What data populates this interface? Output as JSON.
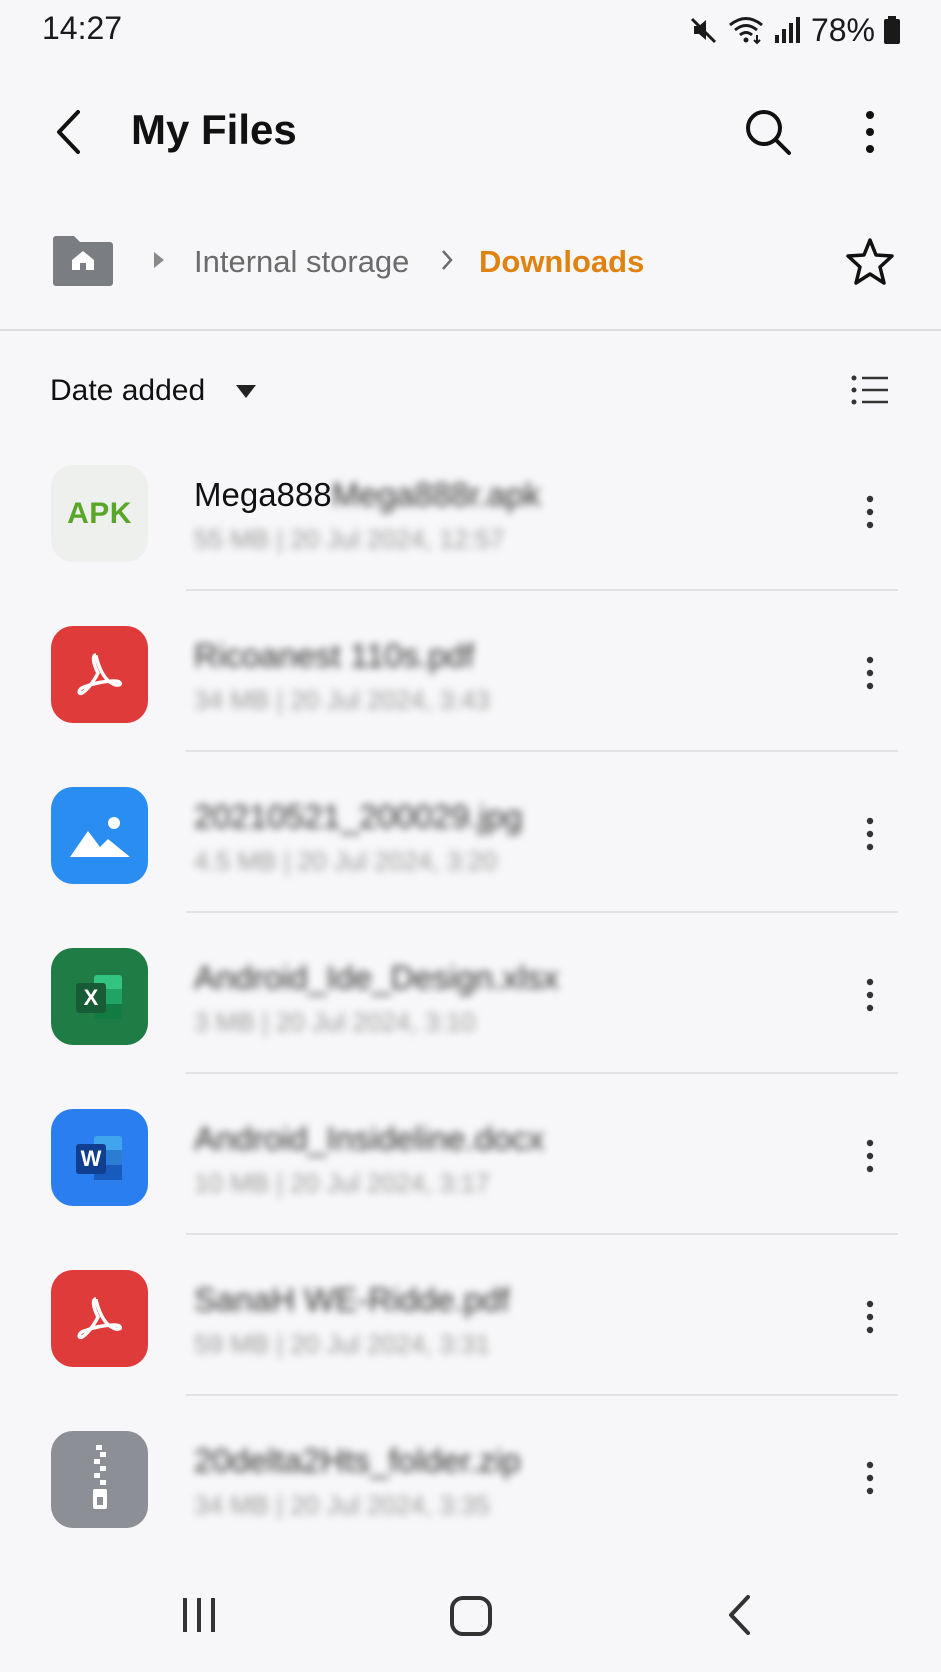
{
  "status_bar": {
    "time": "14:27",
    "battery": "78%",
    "icons": [
      "mute-icon",
      "wifi-icon",
      "signal-icon",
      "battery-icon"
    ]
  },
  "header": {
    "title": "My Files",
    "icons": [
      "back-icon",
      "search-icon",
      "more-vert-icon"
    ]
  },
  "breadcrumb": {
    "items": [
      "Internal storage",
      "Downloads"
    ],
    "active_color": "#e0820f"
  },
  "sort": {
    "label": "Date added"
  },
  "files": [
    {
      "name_visible": "Mega888",
      "name_blurred": "Mega888r.apk",
      "meta": "55 MB  |  20 Jul 2024, 12:57",
      "type": "apk",
      "badge": "APK"
    },
    {
      "name_visible": "",
      "name_blurred": "Ricoanest 110s.pdf",
      "meta": "34 MB  |  20 Jul 2024, 3:43",
      "type": "pdf"
    },
    {
      "name_visible": "",
      "name_blurred": "20210521_200029.jpg",
      "meta": "4.5 MB  |  20 Jul 2024, 3:20",
      "type": "image"
    },
    {
      "name_visible": "",
      "name_blurred": "Android_Ide_Design.xlsx",
      "meta": "3 MB  |  20 Jul 2024, 3:10",
      "type": "excel",
      "badge": "X"
    },
    {
      "name_visible": "",
      "name_blurred": "Android_Insideline.docx",
      "meta": "10 MB  |  20 Jul 2024, 3:17",
      "type": "word",
      "badge": "W"
    },
    {
      "name_visible": "",
      "name_blurred": "SanaH WE-Ridde.pdf",
      "meta": "59 MB  |  20 Jul 2024, 3:31",
      "type": "pdf"
    },
    {
      "name_visible": "",
      "name_blurred": "20delta2Hts_folder.zip",
      "meta": "34 MB  |  20 Jul 2024, 3:35",
      "type": "zip"
    }
  ],
  "nav_bar": {
    "icons": [
      "recents-icon",
      "home-icon",
      "back-icon"
    ]
  }
}
